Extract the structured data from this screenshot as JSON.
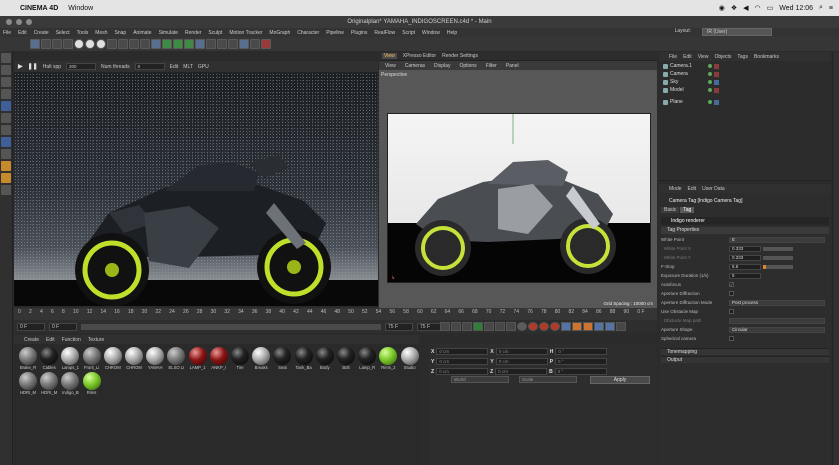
{
  "macos": {
    "app_name": "CINEMA 4D",
    "menu_window": "Window",
    "clock": "Wed 12:06"
  },
  "window": {
    "title": "Originalplan* YAMAHA_INDIGOSCREEN.c4d * - Main",
    "layout_label": "Layout:",
    "layout_value": "IR (User)"
  },
  "menu": [
    "File",
    "Edit",
    "Create",
    "Select",
    "Tools",
    "Mesh",
    "Snap",
    "Animate",
    "Simulate",
    "Render",
    "Sculpt",
    "Motion Tracker",
    "MoGraph",
    "Character",
    "Pipeline",
    "Plugins",
    "RealFlow",
    "Script",
    "Window",
    "Help"
  ],
  "ir_toolbar": {
    "halt_spp_label": "Halt spp",
    "halt_spp_value": "200",
    "num_threads_label": "Num threads",
    "num_threads_value": "0",
    "edit_label": "Edit",
    "mlt_label": "MLT",
    "gpu_label": "GPU"
  },
  "viewport": {
    "tabs": [
      "View",
      "XPresso Editor",
      "Render Settings"
    ],
    "menu": [
      "View",
      "Cameras",
      "Display",
      "Options",
      "Filter",
      "Panel"
    ],
    "label": "Perspective",
    "grid_spacing": "Grid Spacing : 10000 cm"
  },
  "timeline": {
    "ticks": [
      "0",
      "2",
      "4",
      "6",
      "8",
      "10",
      "12",
      "14",
      "16",
      "18",
      "20",
      "22",
      "24",
      "26",
      "28",
      "30",
      "32",
      "34",
      "36",
      "38",
      "40",
      "42",
      "44",
      "46",
      "48",
      "50",
      "52",
      "54",
      "56",
      "58",
      "60",
      "62",
      "64",
      "66",
      "68",
      "70",
      "72",
      "74",
      "76",
      "78",
      "80",
      "82",
      "84",
      "86",
      "88",
      "90"
    ],
    "end_label": "0 F",
    "start_frame": "0 F",
    "start_frame_2": "0 F",
    "end_frame": "75 F",
    "end_frame_2": "75 F"
  },
  "materials": {
    "menu": [
      "Create",
      "Edit",
      "Function",
      "Texture"
    ],
    "items": [
      {
        "name": "Brake_R",
        "style": "tex"
      },
      {
        "name": "Cables",
        "style": "black"
      },
      {
        "name": "Lamps_1",
        "style": "silver"
      },
      {
        "name": "Front_Li",
        "style": "tex"
      },
      {
        "name": "CHROM",
        "style": "silver"
      },
      {
        "name": "CHROM",
        "style": "silver"
      },
      {
        "name": "YAMAH",
        "style": "silver"
      },
      {
        "name": "ELSO LI",
        "style": "tex"
      },
      {
        "name": "LAMP_1",
        "style": "red"
      },
      {
        "name": "ANKP_I",
        "style": "red"
      },
      {
        "name": "Tire",
        "style": "black"
      },
      {
        "name": "Breaks",
        "style": "silver"
      },
      {
        "name": "Seat",
        "style": "black"
      },
      {
        "name": "Tank_Ba",
        "style": "black"
      },
      {
        "name": "Body",
        "style": "black"
      },
      {
        "name": "Bolt",
        "style": "black"
      },
      {
        "name": "Lamp_R",
        "style": "black"
      },
      {
        "name": "Rims_2",
        "style": "green"
      },
      {
        "name": "Studio",
        "style": "silver"
      },
      {
        "name": "HDRI_M",
        "style": "tex"
      },
      {
        "name": "HDRI_M",
        "style": "tex"
      },
      {
        "name": "Indigo_B",
        "style": "tex"
      },
      {
        "name": "Rims",
        "style": "green"
      }
    ]
  },
  "coordinates": {
    "rows": [
      {
        "axis": "X",
        "pos": "0 cm",
        "axis2": "X",
        "size": "0 cm",
        "axis3": "H",
        "rot": "0 °"
      },
      {
        "axis": "Y",
        "pos": "0 cm",
        "axis2": "Y",
        "size": "0 cm",
        "axis3": "P",
        "rot": "0 °"
      },
      {
        "axis": "Z",
        "pos": "0 cm",
        "axis2": "Z",
        "size": "0 cm",
        "axis3": "B",
        "rot": "0 °"
      }
    ],
    "mode_dropdown": "World",
    "size_dropdown": "Scale",
    "apply_label": "Apply"
  },
  "objects": {
    "menu": [
      "File",
      "Edit",
      "View",
      "Objects",
      "Tags",
      "Bookmarks"
    ],
    "items": [
      {
        "name": "Camera.1",
        "tag": "red"
      },
      {
        "name": "Camera",
        "tag": "red"
      },
      {
        "name": "Sky",
        "tag": "blue"
      },
      {
        "name": "Model",
        "tag": "red"
      },
      {
        "name": "Plane",
        "tag": "blue"
      }
    ]
  },
  "attributes": {
    "menu": [
      "Mode",
      "Edit",
      "User Data"
    ],
    "title": "Camera Tag [Indigo Camera Tag]",
    "tabs": [
      "Basic",
      "Tag"
    ],
    "header": "Indigo renderer",
    "section": "Tag Properties",
    "rows": [
      {
        "label": "White Point",
        "value": "E",
        "kind": "wide"
      },
      {
        "label": "· White Point X",
        "value": "0.333",
        "kind": "slider",
        "dim": true
      },
      {
        "label": "· White Point Y",
        "value": "0.333",
        "kind": "slider",
        "dim": true
      },
      {
        "label": "F-Stop",
        "value": "5.6",
        "kind": "slider-o"
      },
      {
        "label": "Exposure Duration (1/s)",
        "value": "5",
        "kind": "plain"
      },
      {
        "label": "Autofocus",
        "value": "✓",
        "kind": "check"
      },
      {
        "label": "Aperture Diffraction",
        "value": "",
        "kind": "check"
      },
      {
        "label": "Aperture Diffraction Mode",
        "value": "Post process",
        "kind": "wide"
      },
      {
        "label": "Use Obstacle Map",
        "value": "",
        "kind": "check"
      },
      {
        "label": "· Obstacle Map path",
        "value": "",
        "kind": "wide",
        "dim": true
      },
      {
        "label": "Aperture Shape",
        "value": "Circular",
        "kind": "wide"
      },
      {
        "label": "Spherical camera",
        "value": "",
        "kind": "check"
      }
    ],
    "collapsed": [
      "Tonemapping",
      "Output"
    ]
  }
}
